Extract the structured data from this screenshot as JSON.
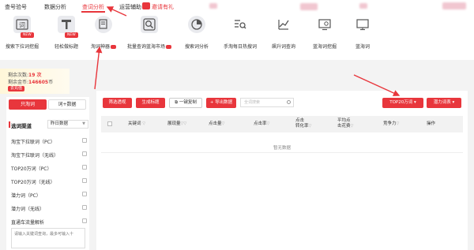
{
  "nav": {
    "items": [
      "查号验号",
      "数据分析",
      "查词分析",
      "运营辅助",
      "邀请有礼"
    ],
    "active": "查词分析",
    "accent": "#e8363c"
  },
  "toolbar": {
    "tools": [
      {
        "label": "搜索下拉词挖掘",
        "icon": "word-icon",
        "tag": "NEW"
      },
      {
        "label": "轻松做标题",
        "icon": "title-icon",
        "tag": "NEW"
      },
      {
        "label": "淘词神器",
        "icon": "search-doc-icon",
        "hot": true
      },
      {
        "label": "批量查询蓝海市场",
        "icon": "magnify-icon",
        "hot": true
      },
      {
        "label": "搜索词分析",
        "icon": "pie-icon"
      },
      {
        "label": "手淘每日热搜词",
        "icon": "list-search-icon"
      },
      {
        "label": "飙升词查询",
        "icon": "chart-icon"
      },
      {
        "label": "蓝海词挖掘",
        "icon": "monitor-icon"
      },
      {
        "label": "蓝海词",
        "icon": "screen-icon"
      }
    ],
    "new_tag": "NEW"
  },
  "stats": {
    "remaining_times_label": "剩余次数:",
    "remaining_times": "19 次",
    "remaining_coins_label": "剩余金币:",
    "remaining_coins": "146605",
    "coin_unit": "币",
    "recharge": "去充值"
  },
  "left": {
    "tab_active": "只淘词",
    "tab_other": "词+数据",
    "channel_title": "选词渠道",
    "date_select": "昨日数据",
    "channels": [
      "淘宝下拉联词（PC）",
      "淘宝下拉联词（无线）",
      "TOP20万词（PC）",
      "TOP20万词（无线）",
      "潜力词（PC）",
      "潜力词（无线）",
      "直通车流量解析"
    ],
    "textarea_placeholder": "请输入关键词查询，最多可输入十"
  },
  "right": {
    "buttons": {
      "filter": "筛选透视",
      "generate_title": "生成标题",
      "copy": "一键复制",
      "export": "导出数据",
      "top20": "TOP20万词",
      "potential": "潜力词表"
    },
    "search_placeholder": "全词搜索",
    "columns": [
      "关键词",
      "展现量",
      "点击量",
      "点击率",
      "点击\n转化率",
      "平均点\n击花费",
      "竞争力",
      "操作"
    ],
    "empty_text": "暂无数据"
  }
}
